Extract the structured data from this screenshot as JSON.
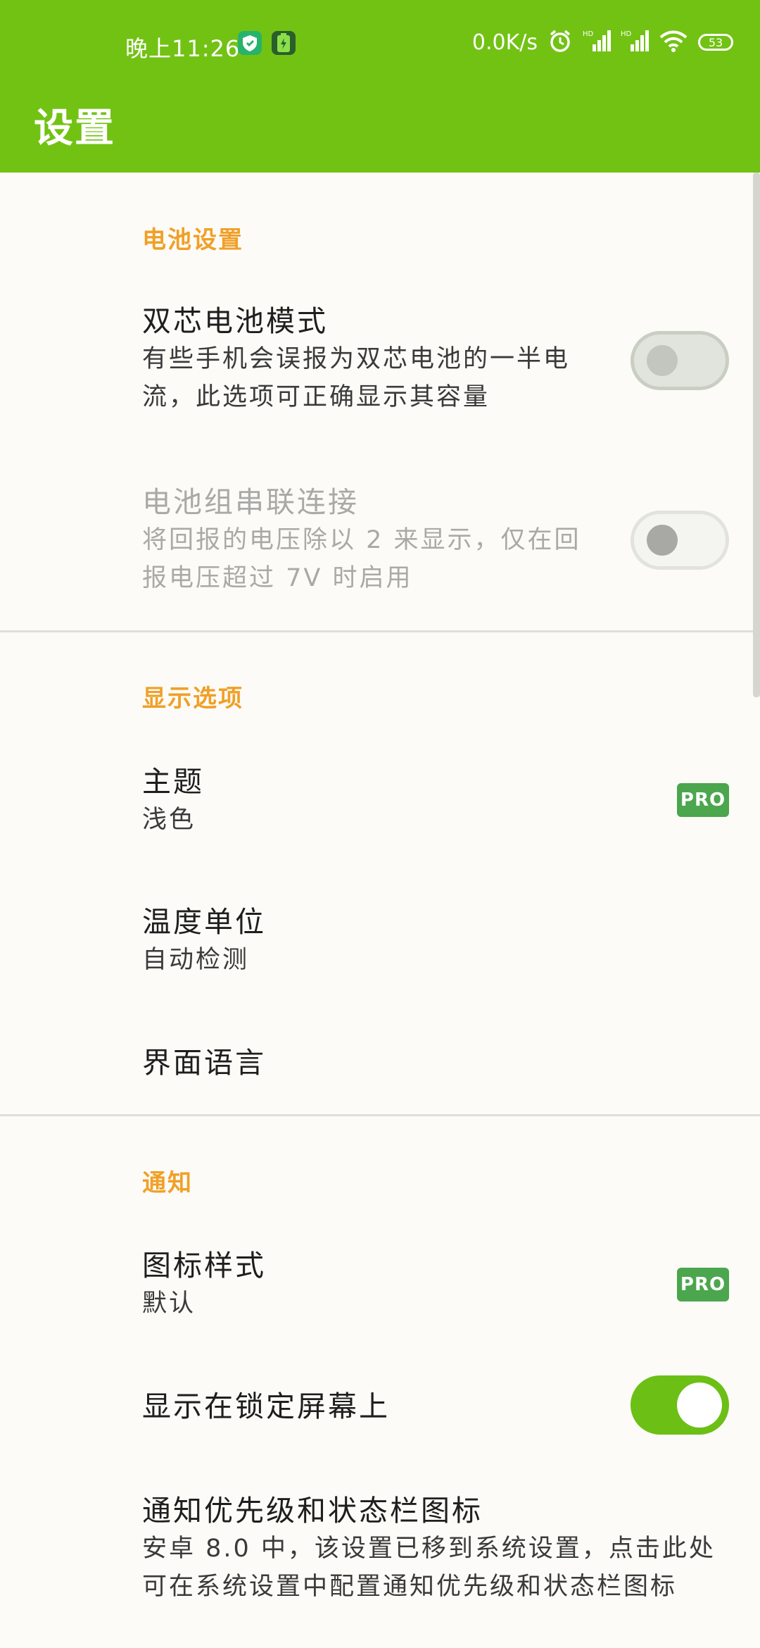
{
  "status_bar": {
    "time": "晚上11:26",
    "net_speed": "0.0K/s",
    "battery_level": "53",
    "icons": [
      "shield-app-icon",
      "battery-app-icon",
      "alarm-icon",
      "signal-hd-icon",
      "signal-hd-icon",
      "wifi-icon",
      "battery-icon"
    ]
  },
  "toolbar": {
    "title": "设置"
  },
  "sections": {
    "battery": {
      "header": "电池设置",
      "dual_cell": {
        "title": "双芯电池模式",
        "summary_line1": "有些手机会误报为双芯电池的一半电",
        "summary_line2": "流，此选项可正确显示其容量",
        "checked": false
      },
      "series": {
        "title": "电池组串联连接",
        "summary_line1": "将回报的电压除以 2 来显示，仅在回",
        "summary_line2": "报电压超过 7V 时启用",
        "checked": false,
        "enabled": false
      }
    },
    "display": {
      "header": "显示选项",
      "theme": {
        "title": "主题",
        "value": "浅色",
        "badge": "PRO"
      },
      "temp_unit": {
        "title": "温度单位",
        "value": "自动检测"
      },
      "language": {
        "title": "界面语言"
      }
    },
    "notification": {
      "header": "通知",
      "icon_style": {
        "title": "图标样式",
        "value": "默认",
        "badge": "PRO"
      },
      "lock_screen": {
        "title": "显示在锁定屏幕上",
        "checked": true
      },
      "priority": {
        "title": "通知优先级和状态栏图标",
        "summary_line1": "安卓 8.0 中，该设置已移到系统设置，点击此处",
        "summary_line2": "可在系统设置中配置通知优先级和状态栏图标"
      }
    }
  },
  "colors": {
    "primary": "#72c214",
    "accent_header": "#f0a028",
    "pro_badge": "#4ba64e",
    "background": "#fcfbf7"
  }
}
